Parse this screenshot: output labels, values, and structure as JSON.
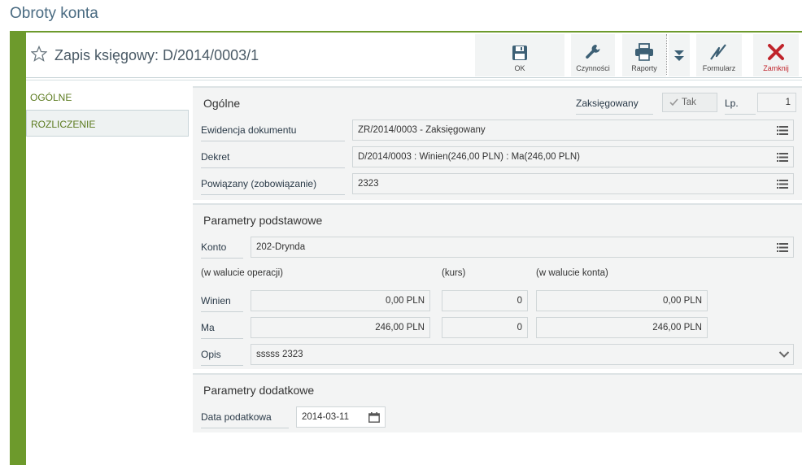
{
  "page": {
    "title": "Obroty konta"
  },
  "header": {
    "doc_title": "Zapis księgowy: D/2014/0003/1"
  },
  "toolbar": {
    "ok_label": "OK",
    "czynnosci_label": "Czynności",
    "raporty_label": "Raporty",
    "formularz_label": "Formularz",
    "zamknij_label": "Zamknij"
  },
  "tabs": [
    {
      "label": "OGÓLNE"
    },
    {
      "label": "ROZLICZENIE"
    }
  ],
  "ogolne": {
    "title": "Ogólne",
    "zaksiegowany_label": "Zaksięgowany",
    "zaksiegowany_value": "Tak",
    "lp_label": "Lp.",
    "lp_value": "1",
    "ewidencja_label": "Ewidencja dokumentu",
    "ewidencja_value": "ZR/2014/0003 - Zaksięgowany",
    "dekret_label": "Dekret",
    "dekret_value": "D/2014/0003 : Winien(246,00 PLN) : Ma(246,00 PLN)",
    "powiazany_label": "Powiązany (zobowiązanie)",
    "powiazany_value": "2323"
  },
  "parametry": {
    "title": "Parametry podstawowe",
    "konto_label": "Konto",
    "konto_value": "202-Drynda",
    "col_operacji": "(w walucie operacji)",
    "col_kurs": "(kurs)",
    "col_konta": "(w walucie konta)",
    "winien_label": "Winien",
    "winien_operacji": "0,00 PLN",
    "winien_kurs": "0",
    "winien_konta": "0,00 PLN",
    "ma_label": "Ma",
    "ma_operacji": "246,00 PLN",
    "ma_kurs": "0",
    "ma_konta": "246,00 PLN",
    "opis_label": "Opis",
    "opis_value": "sssss 2323"
  },
  "dodatkowe": {
    "title": "Parametry dodatkowe",
    "data_label": "Data podatkowa",
    "data_value": "2014-03-11"
  },
  "colors": {
    "accent_green": "#6d9a2c",
    "close_red": "#c0242b",
    "title_blue": "#4a6b82"
  }
}
